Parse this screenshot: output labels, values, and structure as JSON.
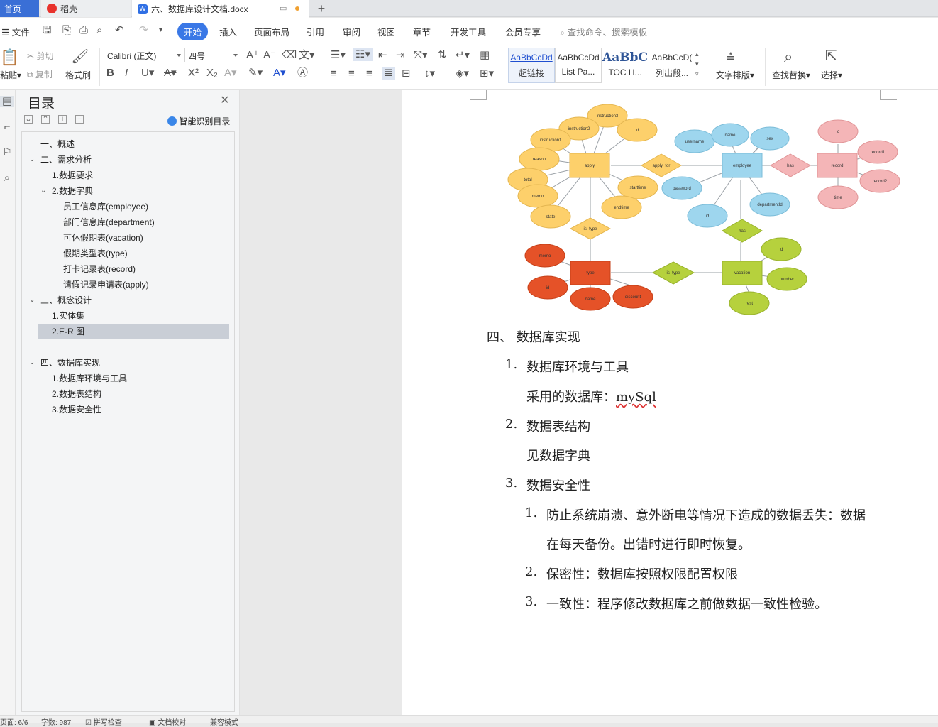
{
  "tabs": {
    "home": "首页",
    "daoke": "稻壳",
    "doc": "六、数据库设计文档.docx",
    "new": "+"
  },
  "menu": {
    "file": "文件",
    "items": [
      "开始",
      "插入",
      "页面布局",
      "引用",
      "审阅",
      "视图",
      "章节",
      "开发工具",
      "会员专享"
    ],
    "search_placeholder": "查找命令、搜索模板"
  },
  "ribbon": {
    "cut": "剪切",
    "copy": "复制",
    "paste": "粘贴",
    "format_painter": "格式刷",
    "font_name": "Calibri (正文)",
    "font_size": "四号",
    "styles": [
      {
        "preview": "AaBbCcDd",
        "name": "超链接"
      },
      {
        "preview": "AaBbCcDd",
        "name": "List Pa..."
      },
      {
        "preview": "AaBbC(",
        "name": "TOC H..."
      },
      {
        "preview": "AaBbCcD(",
        "name": "列出段..."
      }
    ],
    "text_layout": "文字排版",
    "find_replace": "查找替换",
    "select": "选择"
  },
  "toc": {
    "title": "目录",
    "smart": "智能识别目录",
    "items": [
      {
        "label": "一、概述",
        "level": 1
      },
      {
        "label": "二、需求分析",
        "level": 1
      },
      {
        "label": "1.数据要求",
        "level": 2
      },
      {
        "label": "2.数据字典",
        "level": 2
      },
      {
        "label": "员工信息库(employee)",
        "level": 3
      },
      {
        "label": "部门信息库(department)",
        "level": 3
      },
      {
        "label": "可休假期表(vacation)",
        "level": 3
      },
      {
        "label": "假期类型表(type)",
        "level": 3
      },
      {
        "label": "打卡记录表(record)",
        "level": 3
      },
      {
        "label": "请假记录申请表(apply)",
        "level": 3
      },
      {
        "label": "三、概念设计",
        "level": 1
      },
      {
        "label": "1.实体集",
        "level": 2
      },
      {
        "label": "2.E-R 图",
        "level": 2
      },
      {
        "label": "四、数据库实现",
        "level": 1
      },
      {
        "label": "1.数据库环境与工具",
        "level": 2
      },
      {
        "label": "2.数据表结构",
        "level": 2
      },
      {
        "label": "3.数据安全性",
        "level": 2
      }
    ]
  },
  "er": {
    "apply": "apply",
    "apply_for": "apply_for",
    "employee": "employee",
    "has": "has",
    "record": "record",
    "is_type": "is_type",
    "type": "type",
    "vacation": "vacation",
    "apply_attrs": [
      "instruction3",
      "instruction2",
      "instruction1",
      "id",
      "reason",
      "total",
      "memo",
      "state",
      "starttime",
      "endtime"
    ],
    "employee_attrs": [
      "username",
      "name",
      "sex",
      "password",
      "id",
      "departmentId"
    ],
    "record_attrs": [
      "id",
      "record1",
      "record2",
      "time"
    ],
    "type_attrs": [
      "memo",
      "id",
      "name",
      "discount"
    ],
    "vacation_attrs": [
      "id",
      "number",
      "rest"
    ]
  },
  "doc": {
    "heading": "四、 数据库实现",
    "s1_num": "1.",
    "s1": "数据库环境与工具",
    "s1_body_a": "采用的数据库：",
    "s1_body_b": "mySql",
    "s2_num": "2.",
    "s2": "数据表结构",
    "s2_body": "见数据字典",
    "s3_num": "3.",
    "s3": "数据安全性",
    "p1_num": "1.",
    "p1_a": "防止系统崩溃、意外断电等情况下造成的数据丢失：数据",
    "p1_b": "在每天备份。出错时进行即时恢复。",
    "p2_num": "2.",
    "p2": "保密性：数据库按照权限配置权限",
    "p3_num": "3.",
    "p3": "一致性：程序修改数据库之前做数据一致性检验。"
  },
  "status": {
    "page": "页面: 6/6",
    "words": "字数: 987",
    "spell": "拼写检查",
    "proof": "文档校对",
    "mode": "兼容模式"
  }
}
